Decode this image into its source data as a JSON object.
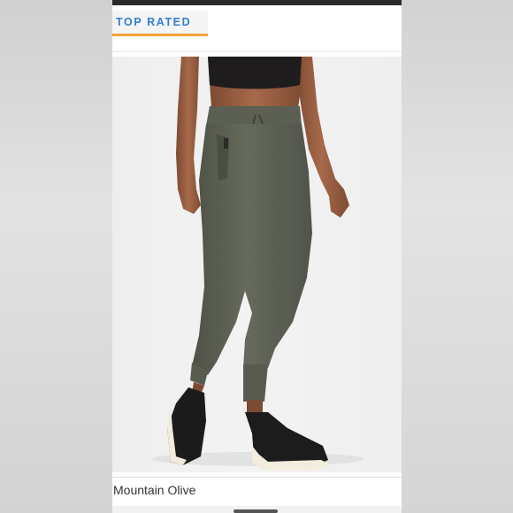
{
  "badge": {
    "label": "TOP RATED"
  },
  "product": {
    "color_name": "Mountain Olive",
    "image_icon": "product-photo-joggers"
  },
  "colors": {
    "badge_text": "#2f7fd2",
    "badge_underline": "#f2a33a",
    "pants": "#5f6355"
  }
}
